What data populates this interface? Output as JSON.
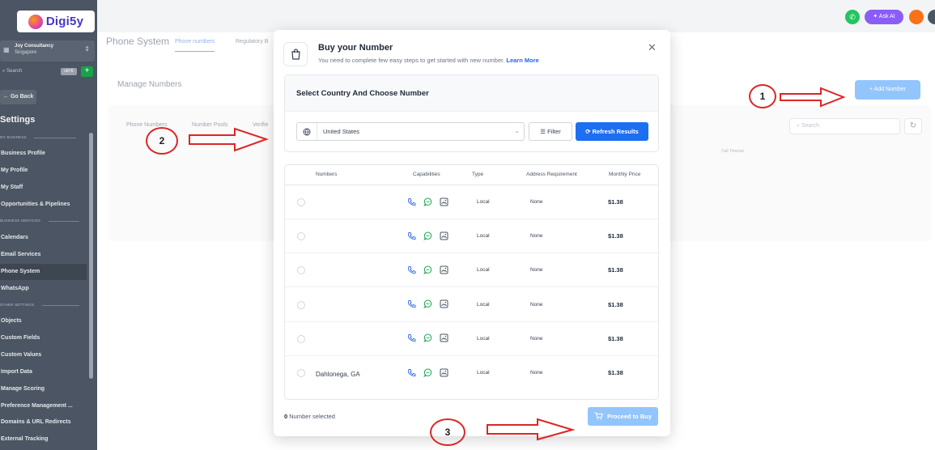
{
  "sidebar": {
    "logo_text": "Digi5y",
    "account_name": "Joy Consultancy",
    "account_location": "Singapore",
    "search_placeholder": "Search",
    "search_shortcut": "ctrl K",
    "go_back": "Go Back",
    "settings_title": "Settings",
    "sections": [
      {
        "label": "MY BUSINESS",
        "items": [
          "Business Profile",
          "My Profile",
          "My Staff",
          "Opportunities & Pipelines"
        ]
      },
      {
        "label": "BUSINESS SERVICES",
        "items": [
          "Calendars",
          "Email Services",
          "Phone System",
          "WhatsApp"
        ]
      },
      {
        "label": "OTHER SETTINGS",
        "items": [
          "Objects",
          "Custom Fields",
          "Custom Values",
          "Import Data",
          "Manage Scoring",
          "Preference Management ...",
          "Domains & URL Redirects",
          "External Tracking"
        ]
      }
    ],
    "active_item": "Phone System"
  },
  "topbar": {
    "ask_ai": "Ask AI"
  },
  "page": {
    "title": "Phone System",
    "tabs": [
      "Phone numbers",
      "Regulatory B"
    ],
    "manage_title": "Manage Numbers",
    "subtabs": [
      "Phone Numbers",
      "Number Pools",
      "Verifie"
    ],
    "search_placeholder": "Search",
    "col_call_timeout": "Call Timeout",
    "add_number": "+ Add Number"
  },
  "modal": {
    "title": "Buy your Number",
    "subtitle": "You need to complete few easy steps to get started with new number.",
    "learn_more": "Learn More",
    "section_title": "Select Country And Choose Number",
    "country": "United States",
    "filter_label": "Filter",
    "refresh_label": "Refresh Results",
    "columns": [
      "Numbers",
      "Capabilities",
      "Type",
      "Address Requirement",
      "Monthly Price"
    ],
    "rows": [
      {
        "number": "",
        "type": "Local",
        "address": "None",
        "price": "$1.38"
      },
      {
        "number": "",
        "type": "Local",
        "address": "None",
        "price": "$1.38"
      },
      {
        "number": "",
        "type": "Local",
        "address": "None",
        "price": "$1.38"
      },
      {
        "number": "",
        "type": "Local",
        "address": "None",
        "price": "$1.38"
      },
      {
        "number": "",
        "type": "Local",
        "address": "None",
        "price": "$1.38"
      },
      {
        "number": "Dahlonega, GA",
        "type": "Local",
        "address": "None",
        "price": "$1.38"
      }
    ],
    "selected_count": "0",
    "selected_suffix": "Number selected",
    "proceed_label": "Proceed to Buy"
  },
  "annotations": [
    "1",
    "2",
    "3"
  ],
  "colors": {
    "primary": "#1d6ff2",
    "disabled_primary": "#93c5fd",
    "annotation": "#dc2626",
    "sidebar": "#4b5563"
  }
}
